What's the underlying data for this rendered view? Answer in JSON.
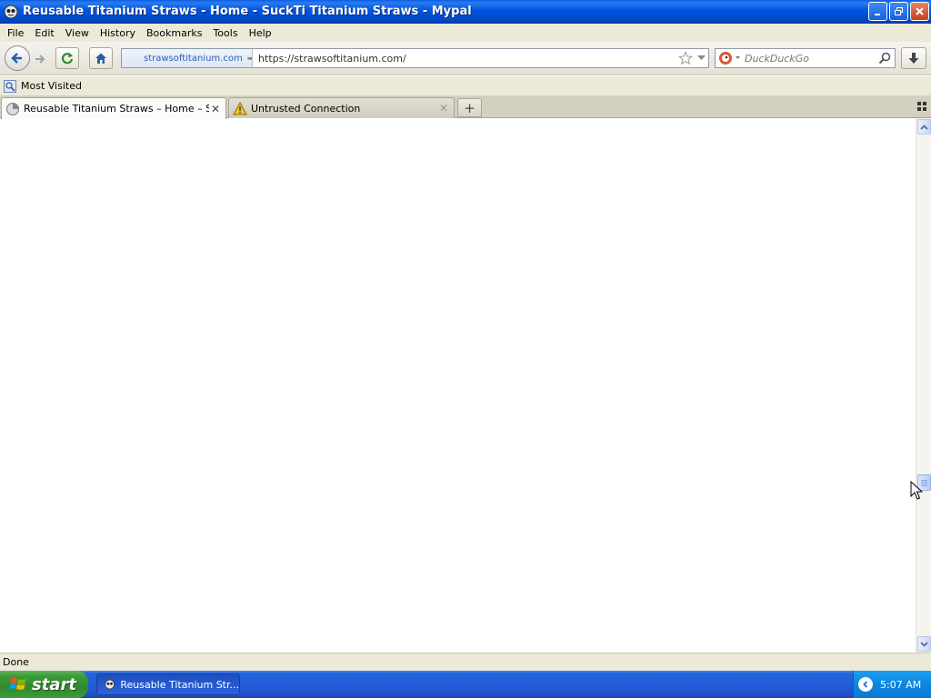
{
  "window": {
    "title": "Reusable Titanium Straws - Home - SuckTi Titanium Straws - Mypal"
  },
  "menu": [
    "File",
    "Edit",
    "View",
    "History",
    "Bookmarks",
    "Tools",
    "Help"
  ],
  "nav": {
    "identity_domain": "strawsoftitanium.com",
    "url": "https://strawsoftitanium.com/",
    "search_placeholder": "DuckDuckGo"
  },
  "bookmarks": [
    {
      "label": "Most Visited",
      "icon": "most-visited-icon"
    }
  ],
  "tabs": [
    {
      "label": "Reusable Titanium Straws – Home – Suck...",
      "icon": "page-loading-icon",
      "active": true
    },
    {
      "label": "Untrusted Connection",
      "icon": "warning-icon",
      "active": false
    }
  ],
  "status": {
    "text": "Done"
  },
  "taskbar": {
    "start_label": "start",
    "task_label": "Reusable Titanium Str...",
    "clock": "5:07 AM"
  },
  "colors": {
    "titlebar": "#0054e3",
    "chrome": "#ece9d8",
    "taskbar": "#245ddb",
    "start": "#3c9a3a",
    "tray": "#0f85e0"
  }
}
